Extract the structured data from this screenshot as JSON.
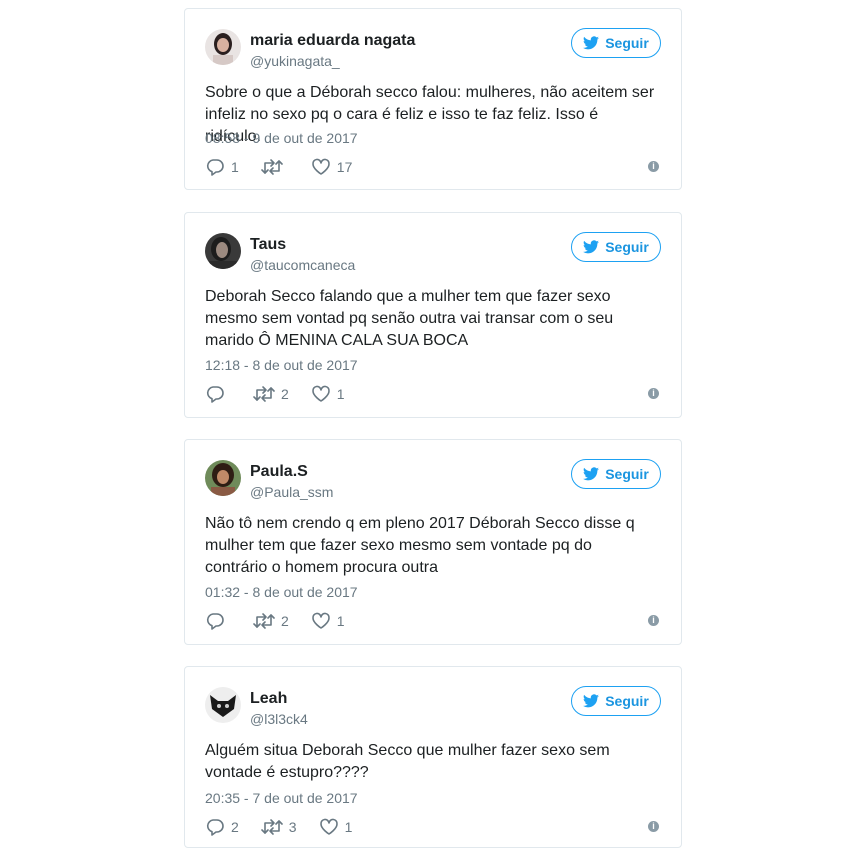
{
  "follow_label": "Seguir",
  "colors": {
    "accent": "#1da1f2",
    "text": "#1c2022",
    "muted": "#697882",
    "border": "#e1e8ed"
  },
  "tweets": [
    {
      "name": "maria eduarda nagata",
      "handle": "@yukinagata_",
      "text": "Sobre o que a Déborah secco falou: mulheres, não aceitem ser infeliz no sexo pq o cara é feliz e isso te faz feliz. Isso é ridículo.",
      "time": "08:58 - 9 de out de 2017",
      "replies": "1",
      "retweets": "",
      "likes": "17"
    },
    {
      "name": "Taus",
      "handle": "@taucomcaneca",
      "text": "Deborah Secco falando que a mulher tem que fazer sexo mesmo sem vontad pq senão outra vai transar com o seu marido Ô MENINA CALA SUA BOCA",
      "time": "12:18 - 8 de out de 2017",
      "replies": "",
      "retweets": "2",
      "likes": "1"
    },
    {
      "name": "Paula.S",
      "handle": "@Paula_ssm",
      "text": "Não tô nem crendo q em pleno 2017 Déborah Secco disse q mulher tem que fazer sexo mesmo sem vontade pq do contrário o homem procura outra",
      "time": "01:32 - 8 de out de 2017",
      "replies": "",
      "retweets": "2",
      "likes": "1"
    },
    {
      "name": "Leah",
      "handle": "@l3l3ck4",
      "text": "Alguém situa Deborah Secco que mulher fazer sexo sem vontade é estupro????",
      "time": "20:35 - 7 de out de 2017",
      "replies": "2",
      "retweets": "3",
      "likes": "1"
    }
  ]
}
